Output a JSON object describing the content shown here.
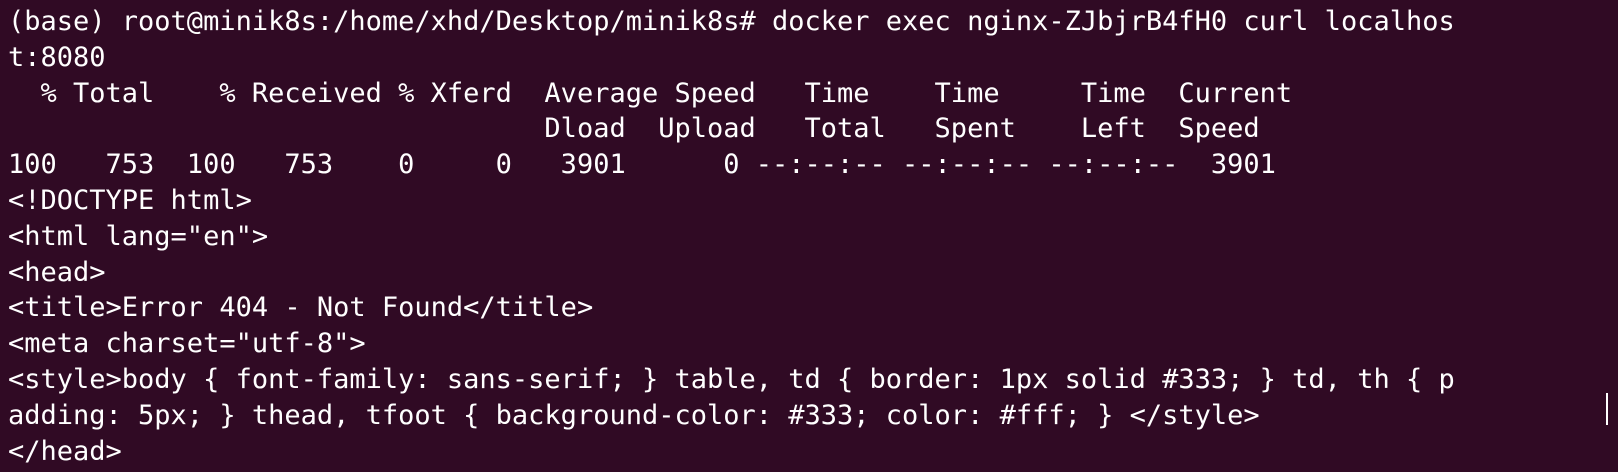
{
  "terminal": {
    "lines": [
      "(base) root@minik8s:/home/xhd/Desktop/minik8s# docker exec nginx-ZJbjrB4fH0 curl localhos",
      "t:8080",
      "  % Total    % Received % Xferd  Average Speed   Time    Time     Time  Current",
      "                                 Dload  Upload   Total   Spent    Left  Speed",
      "100   753  100   753    0     0   3901      0 --:--:-- --:--:-- --:--:--  3901",
      "<!DOCTYPE html>",
      "<html lang=\"en\">",
      "<head>",
      "<title>Error 404 - Not Found</title>",
      "<meta charset=\"utf-8\">",
      "<style>body { font-family: sans-serif; } table, td { border: 1px solid #333; } td, th { p",
      "adding: 5px; } thead, tfoot { background-color: #333; color: #fff; } </style>",
      "</head>"
    ]
  }
}
